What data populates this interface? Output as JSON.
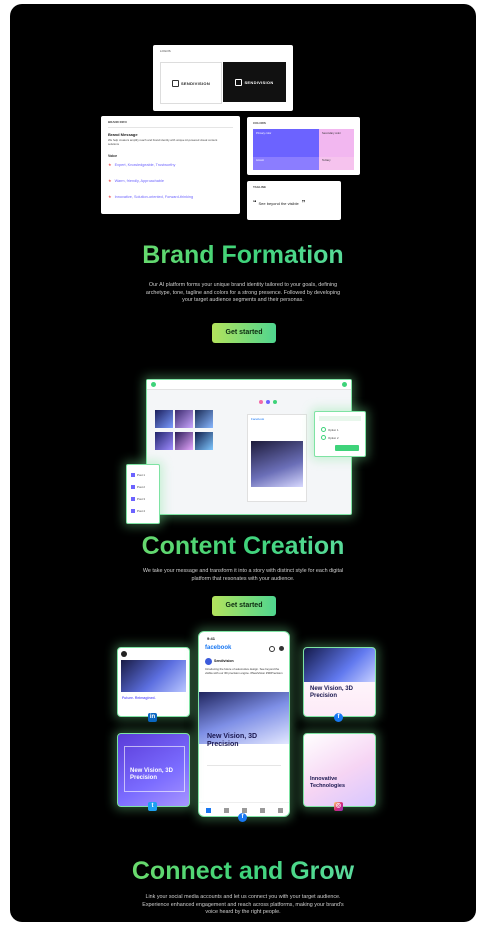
{
  "brand": {
    "logos_label": "LOGOS",
    "logo_text": "SENDIVISION",
    "brand_card_title": "BRAND INFO",
    "message_title": "Brand Message",
    "message_text": "We help creators amplify reach and brand identity with unique AI-powered visual content solutions",
    "voice_title": "Voice",
    "voice_items": [
      "Expert, Knowledgeable, Trustworthy",
      "Warm, friendly, Approachable",
      "Innovative, Solution-oriented, Forward-thinking"
    ],
    "colors_label": "COLORS",
    "color_swatches": [
      "#6c63ff",
      "#f2b7f0",
      "#8b7dff",
      "#f6c3ee"
    ],
    "swatch_labels": [
      "Primary color",
      "Secondary color",
      "Accent",
      "Tertiary"
    ],
    "tagline_label": "TAGLINE",
    "tagline_text": "See beyond the visible",
    "title": "Brand Formation",
    "description": "Our AI platform forms your unique brand identity tailored to your goals, defining archetype, tone, tagline and colors for a strong presence. Followed by developing your target audience segments and their personas.",
    "cta": "Get started"
  },
  "content": {
    "title": "Content Creation",
    "description": "We take your message and transform it into a story with distinct style for each digital platform that resonates with your audience.",
    "cta": "Get started",
    "editor_tab": "Facebook",
    "options": [
      "Option 1",
      "Option 2"
    ],
    "list_items": [
      "Post 1",
      "Post 2",
      "Post 3",
      "Post 4"
    ]
  },
  "connect": {
    "title": "Connect and Grow",
    "description": "Link your social media accounts and let us connect you with your target audience. Experience enhanced engagement and reach across platforms, making your brand's voice heard by the right people.",
    "phone_app": "facebook",
    "phone_time": "9:41",
    "post_author": "Sendivision",
    "post_caption": "Introducing the future of automotive design. See beyond the visible with our 3D precision engine. #NewVision #3DPrecision",
    "card_top_left_caption": "Future. Reimagined.",
    "card_center_title": "New Vision, 3D Precision",
    "card_top_right_title": "New Vision, 3D Precision",
    "card_bottom_left_title": "New Vision, 3D Precision",
    "card_bottom_right_title": "Innovative Technologies",
    "social_icons": [
      "linkedin-icon",
      "facebook-icon",
      "twitter-icon",
      "instagram-icon"
    ],
    "accent_color": "#3ed37a"
  }
}
